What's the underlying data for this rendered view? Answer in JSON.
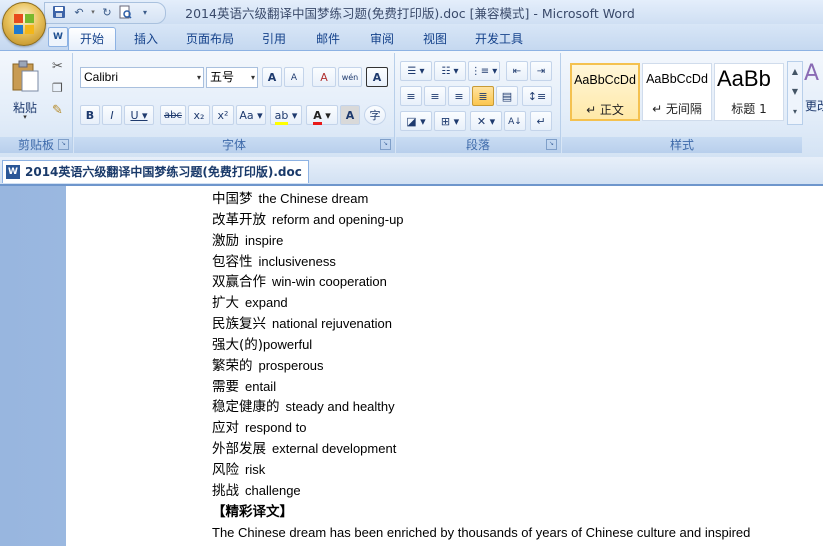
{
  "window": {
    "title": "2014英语六级翻译中国梦练习题(免费打印版).doc [兼容模式] - Microsoft Word"
  },
  "quick_access": {
    "items": [
      "save-icon",
      "undo-icon",
      "redo-icon",
      "print-preview-icon",
      "customize-icon"
    ]
  },
  "tabs": [
    "开始",
    "插入",
    "页面布局",
    "引用",
    "邮件",
    "审阅",
    "视图",
    "开发工具"
  ],
  "active_tab": "开始",
  "ribbon": {
    "clipboard": {
      "label": "剪贴板",
      "paste_label": "粘贴"
    },
    "font": {
      "label": "字体",
      "font_name": "Calibri",
      "font_size": "五号",
      "bold": "B",
      "italic": "I",
      "underline": "U",
      "strike": "abc",
      "subscript": "x₂",
      "superscript": "x²",
      "change_case": "Aa",
      "grow": "A",
      "shrink": "A",
      "clear": "A",
      "phonetic": "wén",
      "border": "A",
      "highlight": "ab",
      "color": "A",
      "shade": "A",
      "enclose": "字"
    },
    "paragraph": {
      "label": "段落"
    },
    "styles": {
      "label": "样式",
      "items": [
        {
          "sample": "AaBbCcDd",
          "name": "↵ 正文"
        },
        {
          "sample": "AaBbCcDd",
          "name": "↵ 无间隔"
        },
        {
          "sample": "AaBb",
          "name": "标题 1"
        }
      ],
      "more_label": "更改"
    }
  },
  "document": {
    "tab_title": "2014英语六级翻译中国梦练习题(免费打印版).doc",
    "glossary": [
      {
        "zh": "中国梦",
        "en": "the Chinese dream"
      },
      {
        "zh": "改革开放",
        "en": "reform and opening-up"
      },
      {
        "zh": "激励",
        "en": "inspire"
      },
      {
        "zh": "包容性",
        "en": "inclusiveness"
      },
      {
        "zh": "双赢合作",
        "en": "win-win cooperation"
      },
      {
        "zh": "扩大",
        "en": "expand"
      },
      {
        "zh": "民族复兴",
        "en": "national rejuvenation"
      },
      {
        "zh": "强大(的)",
        "en": "powerful"
      },
      {
        "zh": "繁荣的",
        "en": "prosperous"
      },
      {
        "zh": "需要",
        "en": "entail"
      },
      {
        "zh": "稳定健康的",
        "en": "steady and healthy"
      },
      {
        "zh": "应对",
        "en": "respond to"
      },
      {
        "zh": "外部发展",
        "en": "external development"
      },
      {
        "zh": "风险",
        "en": "risk"
      },
      {
        "zh": "挑战",
        "en": "challenge"
      }
    ],
    "section_heading": "【精彩译文】",
    "paragraph_start": "The Chinese dream has been enriched by thousands of years of Chinese culture and inspired"
  }
}
